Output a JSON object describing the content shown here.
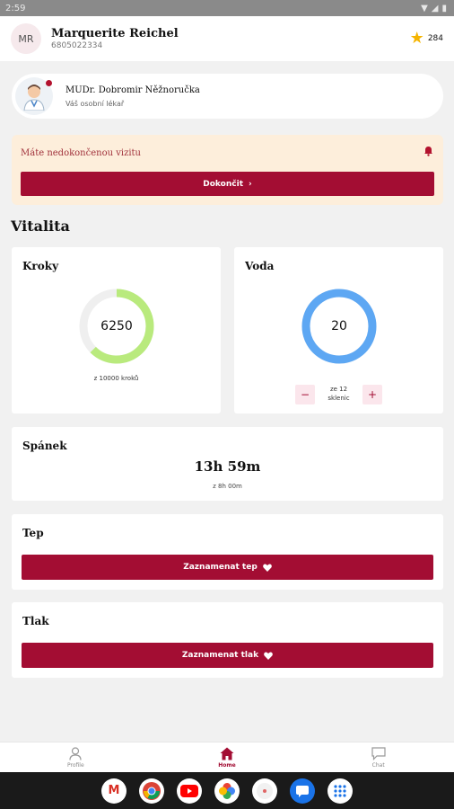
{
  "status_bar": {
    "time": "2:59"
  },
  "header": {
    "avatar_initials": "MR",
    "user_name": "Marquerite Reichel",
    "user_phone": "6805022334",
    "points": "284"
  },
  "doctor": {
    "name": "MUDr. Dobromir Něžnoručka",
    "role": "Váš osobní lékař"
  },
  "alert": {
    "text": "Máte nedokončenou vizitu",
    "button_label": "Dokončit"
  },
  "vitality": {
    "title": "Vitalita",
    "steps": {
      "title": "Kroky",
      "value": "6250",
      "subtitle": "z 10000 kroků",
      "progress": 0.625
    },
    "water": {
      "title": "Voda",
      "value": "20",
      "subtitle_line1": "ze 12",
      "subtitle_line2": "sklenic",
      "progress": 1.0
    },
    "sleep": {
      "title": "Spánek",
      "value": "13h 59m",
      "subtitle": "z 8h 00m"
    },
    "pulse": {
      "title": "Tep",
      "button_label": "Zaznamenat tep"
    },
    "pressure": {
      "title": "Tlak",
      "button_label": "Zaznamenat tlak"
    }
  },
  "bottom_nav": {
    "profile": "Profile",
    "home": "Home",
    "chat": "Chat"
  },
  "colors": {
    "accent": "#a30d33",
    "steps_ring": "#b9ea7d",
    "water_ring": "#5da7f3"
  }
}
